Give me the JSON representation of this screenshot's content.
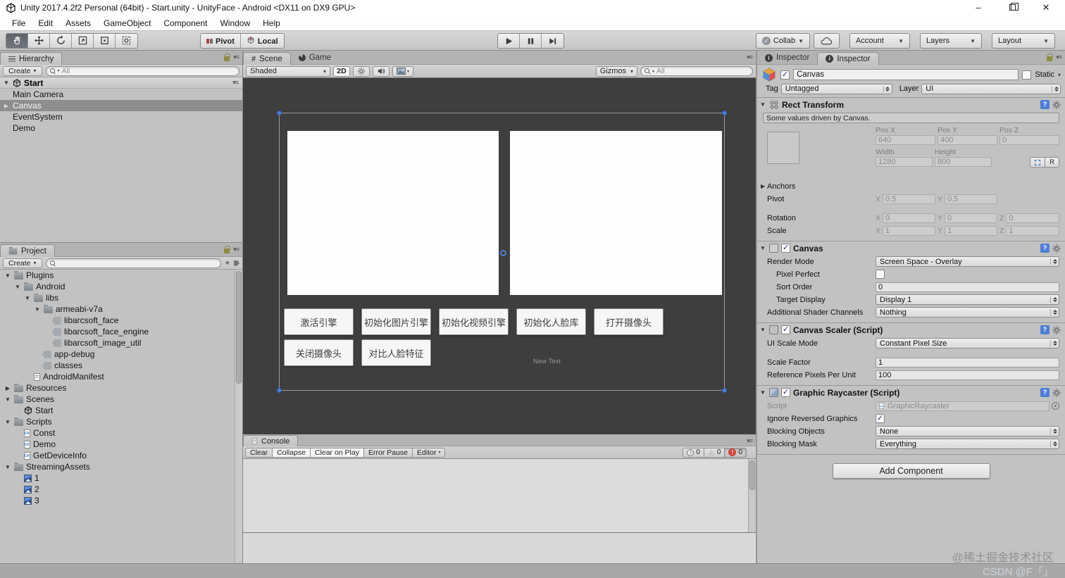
{
  "window": {
    "title": "Unity 2017.4.2f2 Personal (64bit) - Start.unity - UnityFace - Android <DX11 on DX9 GPU>"
  },
  "menubar": [
    "File",
    "Edit",
    "Assets",
    "GameObject",
    "Component",
    "Window",
    "Help"
  ],
  "toolbar": {
    "tools": [
      "hand",
      "move",
      "rotate",
      "scale",
      "rect",
      "transform"
    ],
    "active_tool": "hand",
    "pivot_label": "Pivot",
    "local_label": "Local",
    "collab_label": "Collab",
    "account_label": "Account",
    "layers_label": "Layers",
    "layout_label": "Layout"
  },
  "hierarchy": {
    "tab": "Hierarchy",
    "create_label": "Create",
    "search_text": "All",
    "scene_name": "Start",
    "items": [
      {
        "label": "Main Camera",
        "selected": false,
        "expand": false
      },
      {
        "label": "Canvas",
        "selected": true,
        "expand": true
      },
      {
        "label": "EventSystem",
        "selected": false,
        "expand": false
      },
      {
        "label": "Demo",
        "selected": false,
        "expand": false
      }
    ]
  },
  "project": {
    "tab": "Project",
    "create_label": "Create",
    "search_text": "",
    "items": [
      {
        "label": "Plugins",
        "icon": "folder",
        "depth": 0,
        "exp": "open"
      },
      {
        "label": "Android",
        "icon": "folder",
        "depth": 1,
        "exp": "open"
      },
      {
        "label": "libs",
        "icon": "folder",
        "depth": 2,
        "exp": "open"
      },
      {
        "label": "armeabi-v7a",
        "icon": "folder",
        "depth": 3,
        "exp": "open"
      },
      {
        "label": "libarcsoft_face",
        "icon": "plugin",
        "depth": 4,
        "exp": "none"
      },
      {
        "label": "libarcsoft_face_engine",
        "icon": "plugin",
        "depth": 4,
        "exp": "none"
      },
      {
        "label": "libarcsoft_image_util",
        "icon": "plugin",
        "depth": 4,
        "exp": "none"
      },
      {
        "label": "app-debug",
        "icon": "plugin",
        "depth": 3,
        "exp": "none"
      },
      {
        "label": "classes",
        "icon": "plugin",
        "depth": 3,
        "exp": "none"
      },
      {
        "label": "AndroidManifest",
        "icon": "doc",
        "depth": 2,
        "exp": "none"
      },
      {
        "label": "Resources",
        "icon": "folder",
        "depth": 0,
        "exp": "closed"
      },
      {
        "label": "Scenes",
        "icon": "folder",
        "depth": 0,
        "exp": "open"
      },
      {
        "label": "Start",
        "icon": "unity",
        "depth": 1,
        "exp": "none"
      },
      {
        "label": "Scripts",
        "icon": "folder",
        "depth": 0,
        "exp": "open"
      },
      {
        "label": "Const",
        "icon": "cs",
        "depth": 1,
        "exp": "none"
      },
      {
        "label": "Demo",
        "icon": "cs",
        "depth": 1,
        "exp": "none"
      },
      {
        "label": "GetDeviceInfo",
        "icon": "cs",
        "depth": 1,
        "exp": "none"
      },
      {
        "label": "StreamingAssets",
        "icon": "folder",
        "depth": 0,
        "exp": "open"
      },
      {
        "label": "1",
        "icon": "img",
        "depth": 1,
        "exp": "none"
      },
      {
        "label": "2",
        "icon": "img",
        "depth": 1,
        "exp": "none"
      },
      {
        "label": "3",
        "icon": "img",
        "depth": 1,
        "exp": "none"
      }
    ]
  },
  "scene": {
    "tab_scene": "Scene",
    "tab_game": "Game",
    "shaded_label": "Shaded",
    "mode_2d_label": "2D",
    "gizmos_label": "Gizmos",
    "search_text": "All",
    "canvas_buttons_row1": [
      "激活引擎",
      "初始化图片引擎",
      "初始化视频引擎",
      "初始化人脸库",
      "打开摄像头"
    ],
    "canvas_buttons_row2": [
      "关闭摄像头",
      "对比人脸特征"
    ],
    "text_element": "New Text"
  },
  "console": {
    "tab": "Console",
    "buttons": [
      {
        "label": "Clear",
        "on": false
      },
      {
        "label": "Collapse",
        "on": true
      },
      {
        "label": "Clear on Play",
        "on": true
      },
      {
        "label": "Error Pause",
        "on": false
      }
    ],
    "editor_label": "Editor",
    "info_count": "0",
    "warning_count": "0",
    "error_count": "0"
  },
  "inspector": {
    "tab_left": "Inspector",
    "tab_right": "Inspector",
    "header": {
      "name": "Canvas",
      "static_label": "Static",
      "tag_label": "Tag",
      "tag_value": "Untagged",
      "layer_label": "Layer",
      "layer_value": "UI"
    },
    "rect_transform": {
      "title": "Rect Transform",
      "info": "Some values driven by Canvas.",
      "pos_x_label": "Pos X",
      "pos_y_label": "Pos Y",
      "pos_z_label": "Pos Z",
      "pos_x": "640",
      "pos_y": "400",
      "pos_z": "0",
      "width_label": "Width",
      "height_label": "Height",
      "width": "1280",
      "height": "800",
      "r_button": "R",
      "anchors_label": "Anchors",
      "pivot_label": "Pivot",
      "pivot_x": "0.5",
      "pivot_y": "0.5",
      "rotation_label": "Rotation",
      "rot_x": "0",
      "rot_y": "0",
      "rot_z": "0",
      "scale_label": "Scale",
      "scale_x": "1",
      "scale_y": "1",
      "scale_z": "1"
    },
    "canvas": {
      "title": "Canvas",
      "render_mode_label": "Render Mode",
      "render_mode": "Screen Space - Overlay",
      "pixel_perfect_label": "Pixel Perfect",
      "sort_order_label": "Sort Order",
      "sort_order": "0",
      "target_display_label": "Target Display",
      "target_display": "Display 1",
      "shader_channels_label": "Additional Shader Channels",
      "shader_channels": "Nothing"
    },
    "canvas_scaler": {
      "title": "Canvas Scaler (Script)",
      "ui_scale_mode_label": "UI Scale Mode",
      "ui_scale_mode": "Constant Pixel Size",
      "scale_factor_label": "Scale Factor",
      "scale_factor": "1",
      "ref_ppu_label": "Reference Pixels Per Unit",
      "ref_ppu": "100"
    },
    "graphic_raycaster": {
      "title": "Graphic Raycaster (Script)",
      "script_label": "Script",
      "script_value": "GraphicRaycaster",
      "ignore_reversed_label": "Ignore Reversed Graphics",
      "blocking_objects_label": "Blocking Objects",
      "blocking_objects": "None",
      "blocking_mask_label": "Blocking Mask",
      "blocking_mask": "Everything"
    },
    "add_component_label": "Add Component"
  },
  "watermark": {
    "line1": "@稀土掘金技术社区",
    "line2": "CSDN @F「」"
  },
  "colors": {
    "selection_blue": "#4a80d8",
    "scene_background": "#3e3e3e",
    "error_red": "#cf4436",
    "panel_gray": "#c2c2c2"
  }
}
